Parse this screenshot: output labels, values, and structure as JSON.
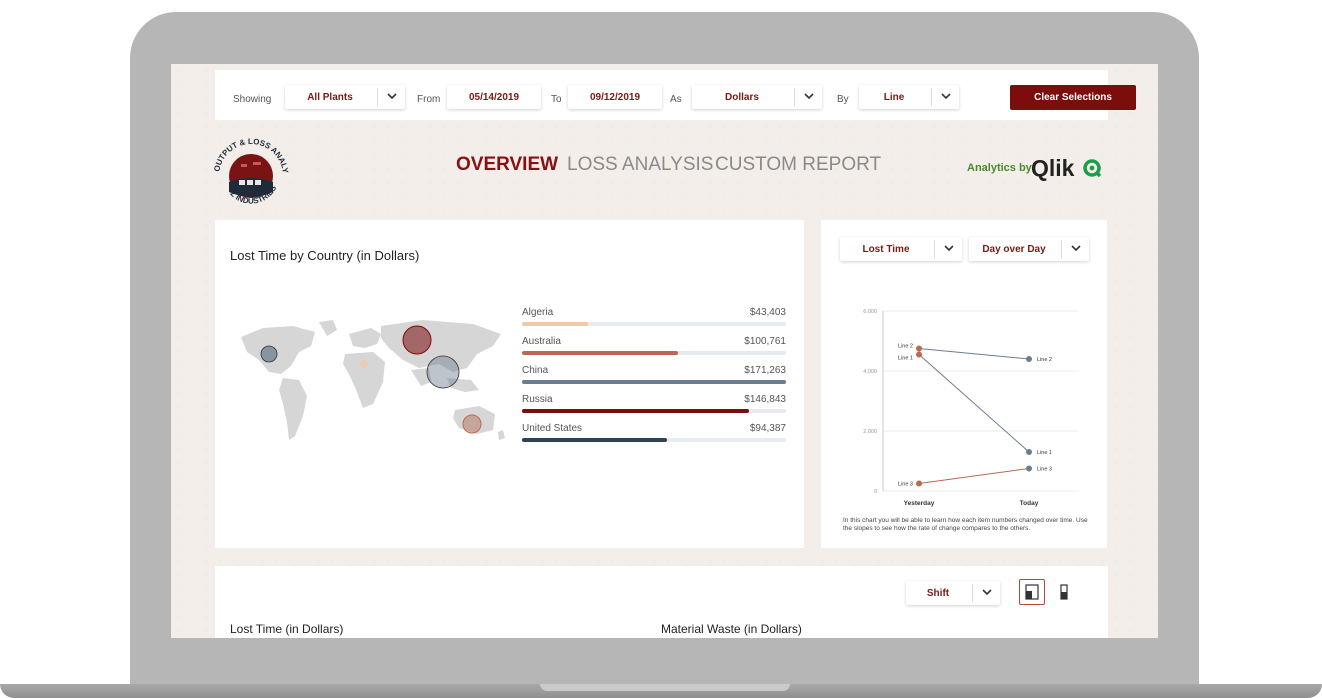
{
  "toolbar": {
    "showing_label": "Showing",
    "plants": "All Plants",
    "from_label": "From",
    "from_date": "05/14/2019",
    "to_label": "To",
    "to_date": "09/12/2019",
    "as_label": "As",
    "units": "Dollars",
    "by_label": "By",
    "by": "Line",
    "clear": "Clear Selections"
  },
  "logo": {
    "top_text": "OUTPUT & LOSS ANALYSIS",
    "bottom_text": "Z INDUSTRIES"
  },
  "nav": {
    "overview": "OVERVIEW",
    "loss_analysis": "LOSS ANALYSIS",
    "custom_report": "CUSTOM REPORT"
  },
  "brand": {
    "analytics": "Analytics by",
    "qlik": "Qlik"
  },
  "map_card": {
    "title": "Lost Time by Country (in Dollars)",
    "countries": [
      {
        "name": "Algeria",
        "value": "$43,403",
        "fraction": 0.25,
        "color": "#f0c9a6"
      },
      {
        "name": "Australia",
        "value": "$100,761",
        "fraction": 0.59,
        "color": "#b86a52"
      },
      {
        "name": "China",
        "value": "$171,263",
        "fraction": 1.0,
        "color": "#6c7d8f"
      },
      {
        "name": "Russia",
        "value": "$146,843",
        "fraction": 0.86,
        "color": "#7c0d0d"
      },
      {
        "name": "United States",
        "value": "$94,387",
        "fraction": 0.55,
        "color": "#2d4256"
      }
    ]
  },
  "slope_card": {
    "measure": "Lost Time",
    "comparison": "Day over Day",
    "note": "In this chart you will be able to learn how each item numbers changed over time. Use the slopes to see how the rate of change compares to the others."
  },
  "chart_data": {
    "type": "line",
    "x": [
      "Yesterday",
      "Today"
    ],
    "ylim": [
      0,
      6000
    ],
    "yticks": [
      "0",
      "2,000",
      "4,000",
      "6,000"
    ],
    "series": [
      {
        "name": "Line 1",
        "values": [
          4550,
          1300
        ],
        "color": "#6c7d8f",
        "start_color": "#b86a52"
      },
      {
        "name": "Line 2",
        "values": [
          4750,
          4400
        ],
        "color": "#6c7d8f",
        "start_color": "#b86a52"
      },
      {
        "name": "Line 3",
        "values": [
          250,
          750
        ],
        "color": "#b86a52",
        "start_color": "#b86a52"
      }
    ],
    "grid": true
  },
  "bottom_card": {
    "shift": "Shift",
    "lost_time_title": "Lost Time (in Dollars)",
    "material_waste_title": "Material Waste (in Dollars)"
  }
}
